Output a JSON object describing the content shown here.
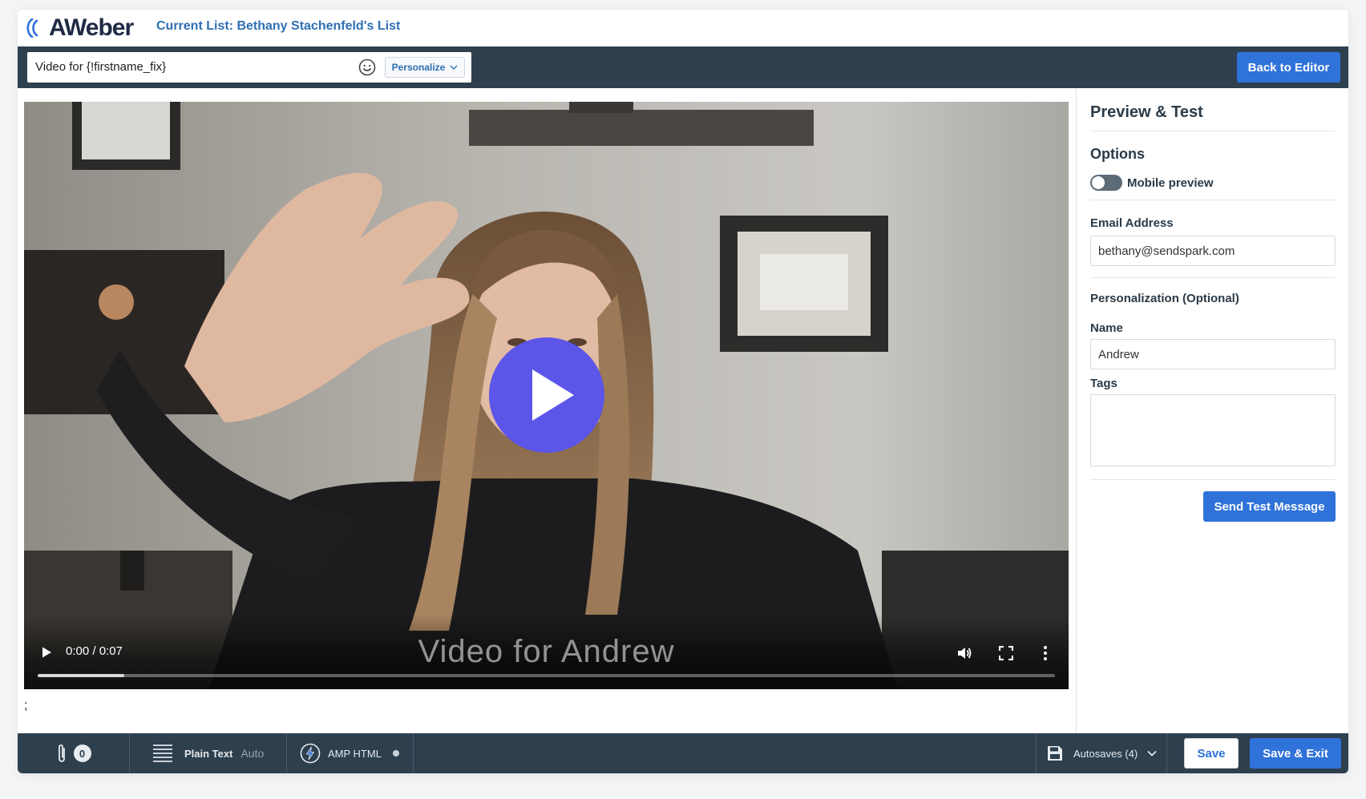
{
  "header": {
    "logo_text": "AWeber",
    "current_list": "Current List: Bethany Stachenfeld's List"
  },
  "subject": {
    "value": "Video for {!firstname_fix}",
    "personalize_label": "Personalize",
    "back_to_editor_label": "Back to Editor"
  },
  "video": {
    "time": "0:00 / 0:07",
    "caption": "Video for Andrew",
    "progress": 0.085,
    "play_color": "#5b55e8"
  },
  "body_text": ";",
  "panel": {
    "title": "Preview & Test",
    "options_label": "Options",
    "mobile_preview_label": "Mobile preview",
    "mobile_preview_on": false,
    "email_label": "Email Address",
    "email_value": "bethany@sendspark.com",
    "personalization_label": "Personalization (Optional)",
    "name_label": "Name",
    "name_value": "Andrew",
    "tags_label": "Tags",
    "tags_value": "",
    "send_test_label": "Send Test Message"
  },
  "bottom": {
    "attachments_count": "0",
    "plain_text_label": "Plain Text",
    "plain_text_mode": "Auto",
    "amp_label": "AMP HTML",
    "autosaves_label": "Autosaves (4)",
    "save_label": "Save",
    "save_exit_label": "Save & Exit"
  },
  "colors": {
    "accent": "#2f72d9",
    "toolbar": "#2e3f4e",
    "link": "#2f6fb3"
  }
}
